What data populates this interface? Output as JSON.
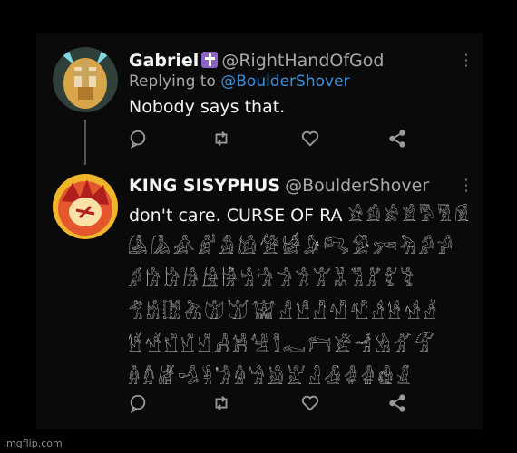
{
  "tweet1": {
    "display_name": "Gabriel",
    "verified_icon": "cross-badge-icon",
    "handle": "@RightHandOfGod",
    "replying_prefix": "Replying to",
    "replying_to": "@BoulderShover",
    "text": "Nobody says that."
  },
  "tweet2": {
    "display_name": "KING SISYPHUS",
    "handle": "@BoulderShover",
    "text": "don't care. CURSE OF RA",
    "glyph_rows": [
      "𓀀𓀁𓀂𓀃𓀄𓀅𓀆",
      "𓀇𓀈𓀉𓀊𓀋𓀌𓀍𓀎𓀏𓀐𓀑𓀒𓀓𓀔𓀕",
      "𓀖𓀗𓀘𓀙𓀚𓀛𓀜𓀝𓀞𓀟𓀠𓀡𓀢𓀣𓀤𓀥",
      "𓀦𓀧𓀨𓀩𓀪𓀫𓀬𓀭𓀮𓀯𓀰𓀱𓀲𓀳𓀴𓀵",
      "𓀶𓀷𓀸𓀹𓀺𓀻𓀼𓀽𓀾𓀿𓁀𓁁𓁂𓁃𓁄𓁅",
      "𓁆𓁇𓁈𓁉𓁊𓁋𓁌𓁍𓁎𓁏𓁐𓁑𓁒𓁓𓁔𓁕"
    ]
  },
  "actions": [
    "comment-icon",
    "retweet-icon",
    "like-icon",
    "share-icon"
  ],
  "watermark": "imgflip.com",
  "colors": {
    "mention": "#3b8fd9",
    "muted": "#a8a8a8",
    "background": "#000000"
  }
}
